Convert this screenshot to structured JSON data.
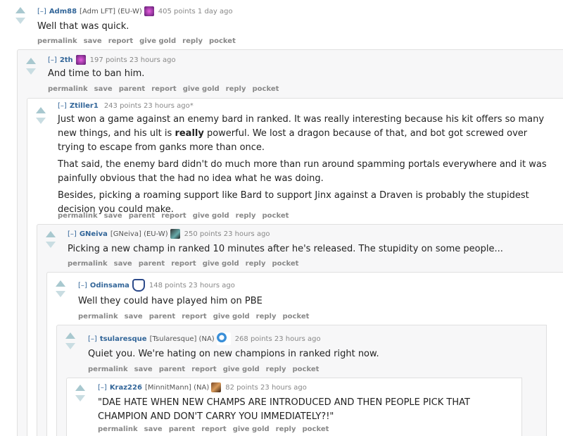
{
  "comments": [
    {
      "collapse": "[–]",
      "author": "Adm88",
      "flair": "[Adm LFT] (EU-W)",
      "points": "405 points 1 day ago",
      "body": [
        "Well that was quick."
      ],
      "buttons": [
        "permalink",
        "save",
        "report",
        "give gold",
        "reply",
        "pocket"
      ]
    },
    {
      "collapse": "[–]",
      "author": "2th",
      "flair": "",
      "points": "197 points 23 hours ago",
      "body": [
        "And time to ban him."
      ],
      "buttons": [
        "permalink",
        "save",
        "parent",
        "report",
        "give gold",
        "reply",
        "pocket"
      ]
    },
    {
      "collapse": "[–]",
      "author": "Ztiller1",
      "flair": "",
      "points": "243 points 23 hours ago*",
      "body_p1_pre": "Just won a game against an enemy bard in ranked. It was really interesting because his kit offers so many new things, and his ult is ",
      "body_p1_bold": "really",
      "body_p1_post": " powerful. We lost a dragon because of that, and bot got screwed over trying to escape from ganks more than once.",
      "body_p2": "That said, the enemy bard didn't do much more than run around spamming portals everywhere and it was painfully obvious that the had no idea what he was doing.",
      "body_p3": "Besides, picking a roaming support like Bard to support Jinx against a Draven is probably the stupidest decision you could make.",
      "buttons": [
        "permalink",
        "save",
        "parent",
        "report",
        "give gold",
        "reply",
        "pocket"
      ]
    },
    {
      "collapse": "[–]",
      "author": "GNeiva",
      "flair": "[GNeiva] (EU-W)",
      "points": "250 points 23 hours ago",
      "body": [
        "Picking a new champ in ranked 10 minutes after he's released. The stupidity on some people..."
      ],
      "buttons": [
        "permalink",
        "save",
        "parent",
        "report",
        "give gold",
        "reply",
        "pocket"
      ]
    },
    {
      "collapse": "[–]",
      "author": "Odinsama",
      "flair": "",
      "points": "148 points 23 hours ago",
      "body": [
        "Well they could have played him on PBE"
      ],
      "buttons": [
        "permalink",
        "save",
        "parent",
        "report",
        "give gold",
        "reply",
        "pocket"
      ]
    },
    {
      "collapse": "[–]",
      "author": "tsularesque",
      "flair": "[Tsularesque] (NA)",
      "points": "268 points 23 hours ago",
      "body": [
        "Quiet you. We're hating on new champions in ranked right now."
      ],
      "buttons": [
        "permalink",
        "save",
        "parent",
        "report",
        "give gold",
        "reply",
        "pocket"
      ]
    },
    {
      "collapse": "[–]",
      "author": "Kraz226",
      "flair": "[MinnitMann] (NA)",
      "points": "82 points 23 hours ago",
      "body": [
        "\"DAE HATE WHEN NEW CHAMPS ARE INTRODUCED AND THEN PEOPLE PICK THAT CHAMPION AND DON'T CARRY YOU IMMEDIATELY?!\""
      ],
      "buttons": [
        "permalink",
        "save",
        "parent",
        "report",
        "give gold",
        "reply",
        "pocket"
      ]
    }
  ],
  "icons": {
    "upvote": "upvote-arrow-icon",
    "downvote": "downvote-arrow-icon",
    "flair": "user-flair-icon"
  },
  "colors": {
    "author": "#336699",
    "meta": "#888888",
    "arrow": "#a8c8cf",
    "nested_bg": "#f7f7f8",
    "border": "#e0e0e0"
  }
}
